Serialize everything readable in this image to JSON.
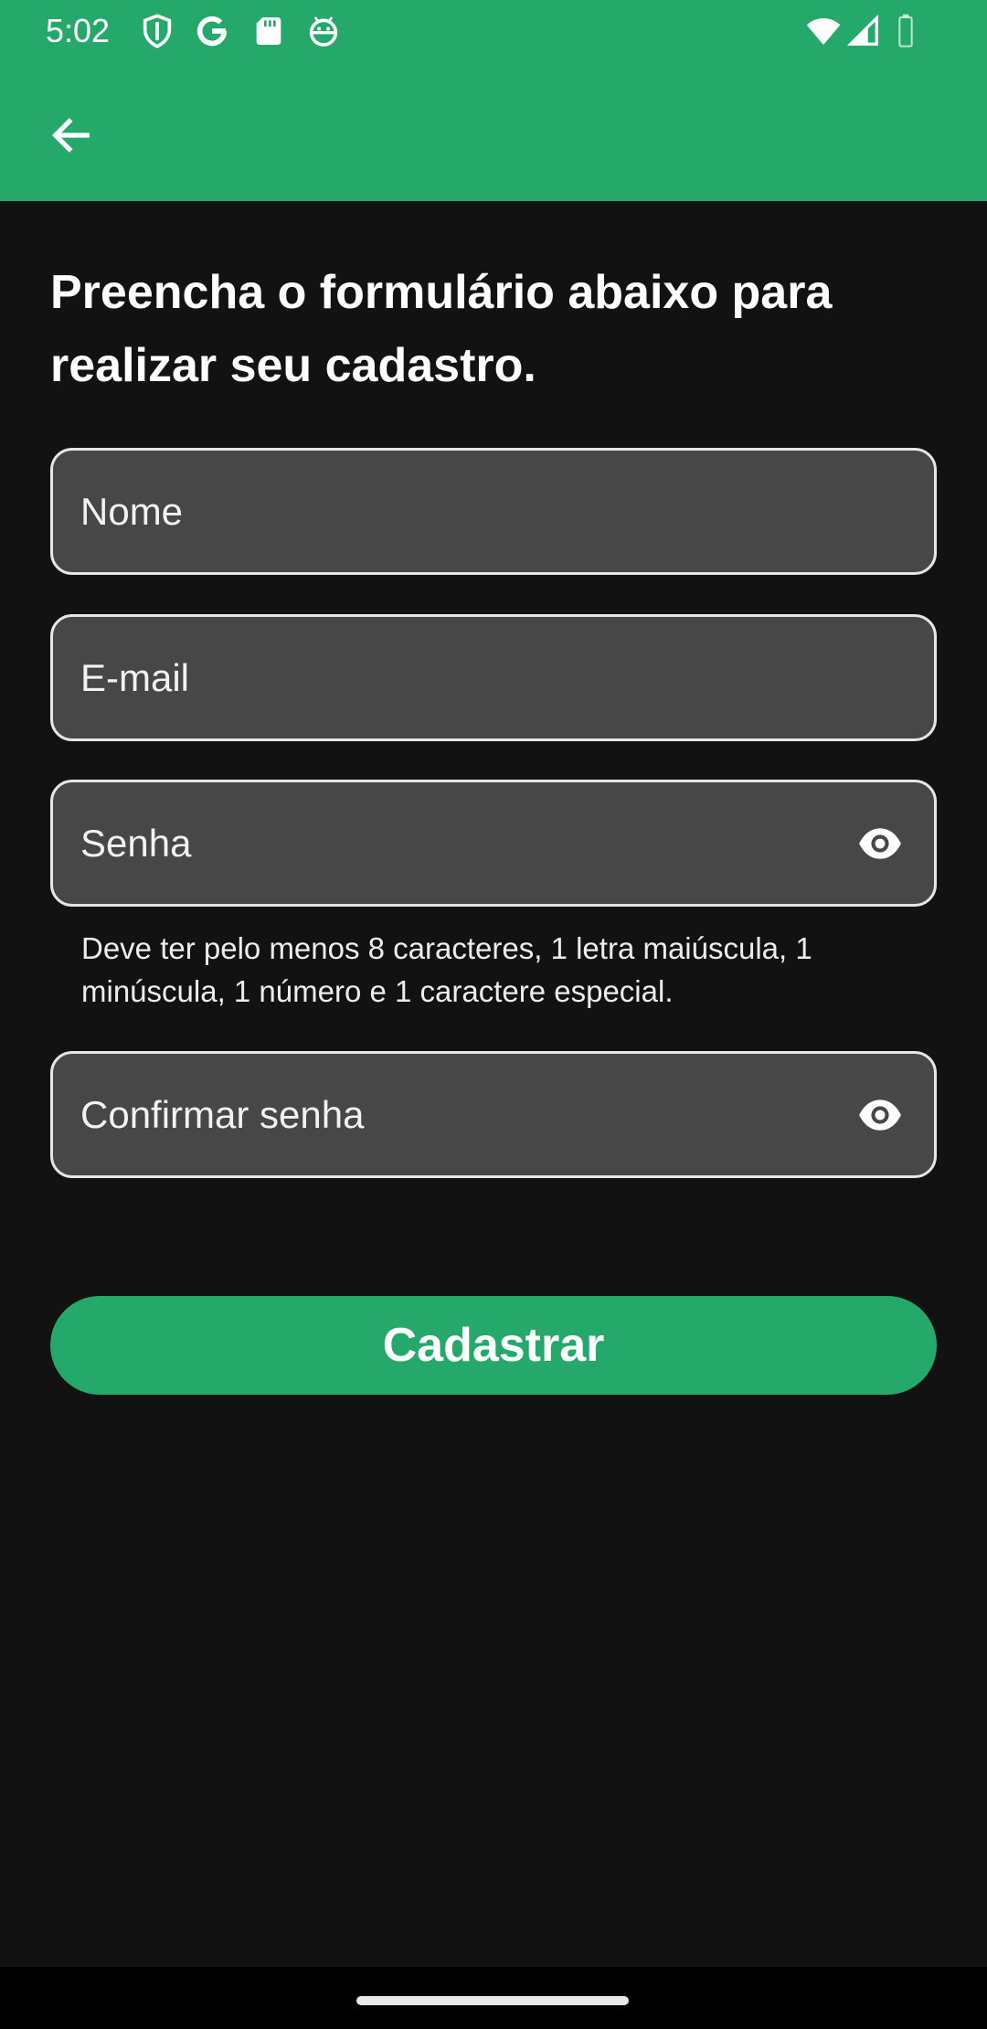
{
  "status_bar": {
    "time": "5:02",
    "icons": [
      "shield-icon",
      "google-icon",
      "sd-card-icon",
      "android-icon",
      "wifi-icon",
      "signal-icon",
      "battery-icon"
    ]
  },
  "app_bar": {
    "back_icon": "arrow-back-icon",
    "color": "#24A96A"
  },
  "form": {
    "heading": "Preencha o formulário abaixo para realizar seu cadastro.",
    "name": {
      "placeholder": "Nome",
      "value": ""
    },
    "email": {
      "placeholder": "E-mail",
      "value": ""
    },
    "password": {
      "placeholder": "Senha",
      "value": "",
      "toggle_icon": "eye-icon"
    },
    "password_helper": "Deve ter pelo menos 8 caracteres, 1 letra maiúscula, 1 minúscula, 1 número e 1 caractere especial.",
    "confirm_password": {
      "placeholder": "Confirmar senha",
      "value": "",
      "toggle_icon": "eye-icon"
    },
    "submit_label": "Cadastrar"
  },
  "colors": {
    "accent": "#24A96A",
    "background": "#121212",
    "field_bg": "#474747"
  }
}
